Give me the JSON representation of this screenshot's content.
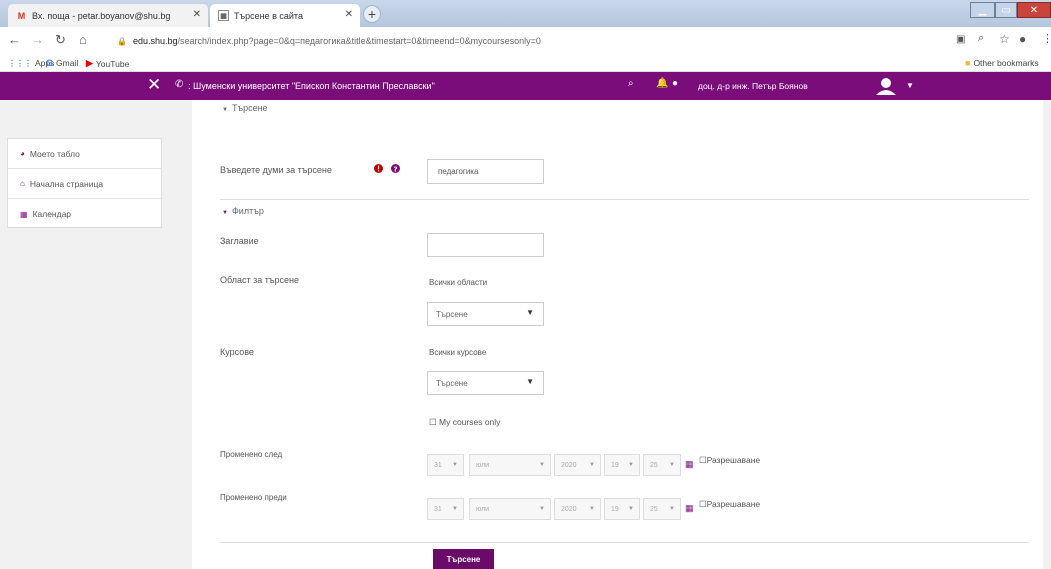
{
  "tabs": [
    {
      "title": "Вх. поща - petar.boyanov@shu.bg",
      "favicon": "gmail-icon"
    },
    {
      "title": "Търсене в сайта",
      "favicon": "moodle-icon"
    }
  ],
  "address": {
    "domain": "edu.shu.bg",
    "path": "/search/index.php?page=0&q=педагогика&title&timestart=0&timeend=0&mycoursesonly=0"
  },
  "bookmarks": [
    "Apps",
    "Gmail",
    "YouTube"
  ],
  "other_bookmarks": "Other bookmarks",
  "header": {
    "site_name": ": Шуменски университет \"Епископ Константин Преславски\"",
    "user_name": "доц. д-р инж. Петър Боянов"
  },
  "sidebar": [
    {
      "label": "Моето табло",
      "icon": "dashboard-icon"
    },
    {
      "label": "Начална страница",
      "icon": "home-icon"
    },
    {
      "label": "Календар",
      "icon": "calendar-icon"
    }
  ],
  "form": {
    "search_section": "Търсене",
    "query_label": "Въведете думи за търсене",
    "query_value": "педагогика",
    "filter_section": "Филтър",
    "title_label": "Заглавие",
    "title_value": "",
    "area_label": "Област за търсене",
    "area_value_text": "Всички области",
    "area_select": "Търсене",
    "courses_label": "Курсове",
    "courses_value_text": "Всички курсове",
    "courses_select": "Търсене",
    "mycourses_label": "My courses only",
    "after_label": "Променено след",
    "before_label": "Променено преди",
    "date_day": "31",
    "date_month": "юли",
    "date_year": "2020",
    "date_hour": "19",
    "date_minute": "25",
    "enable_label": "Разрешаване",
    "submit_label": "Търсене"
  },
  "colors": {
    "brand": "#7b0d7b",
    "button": "#6a0b6a",
    "required": "#c00000"
  }
}
